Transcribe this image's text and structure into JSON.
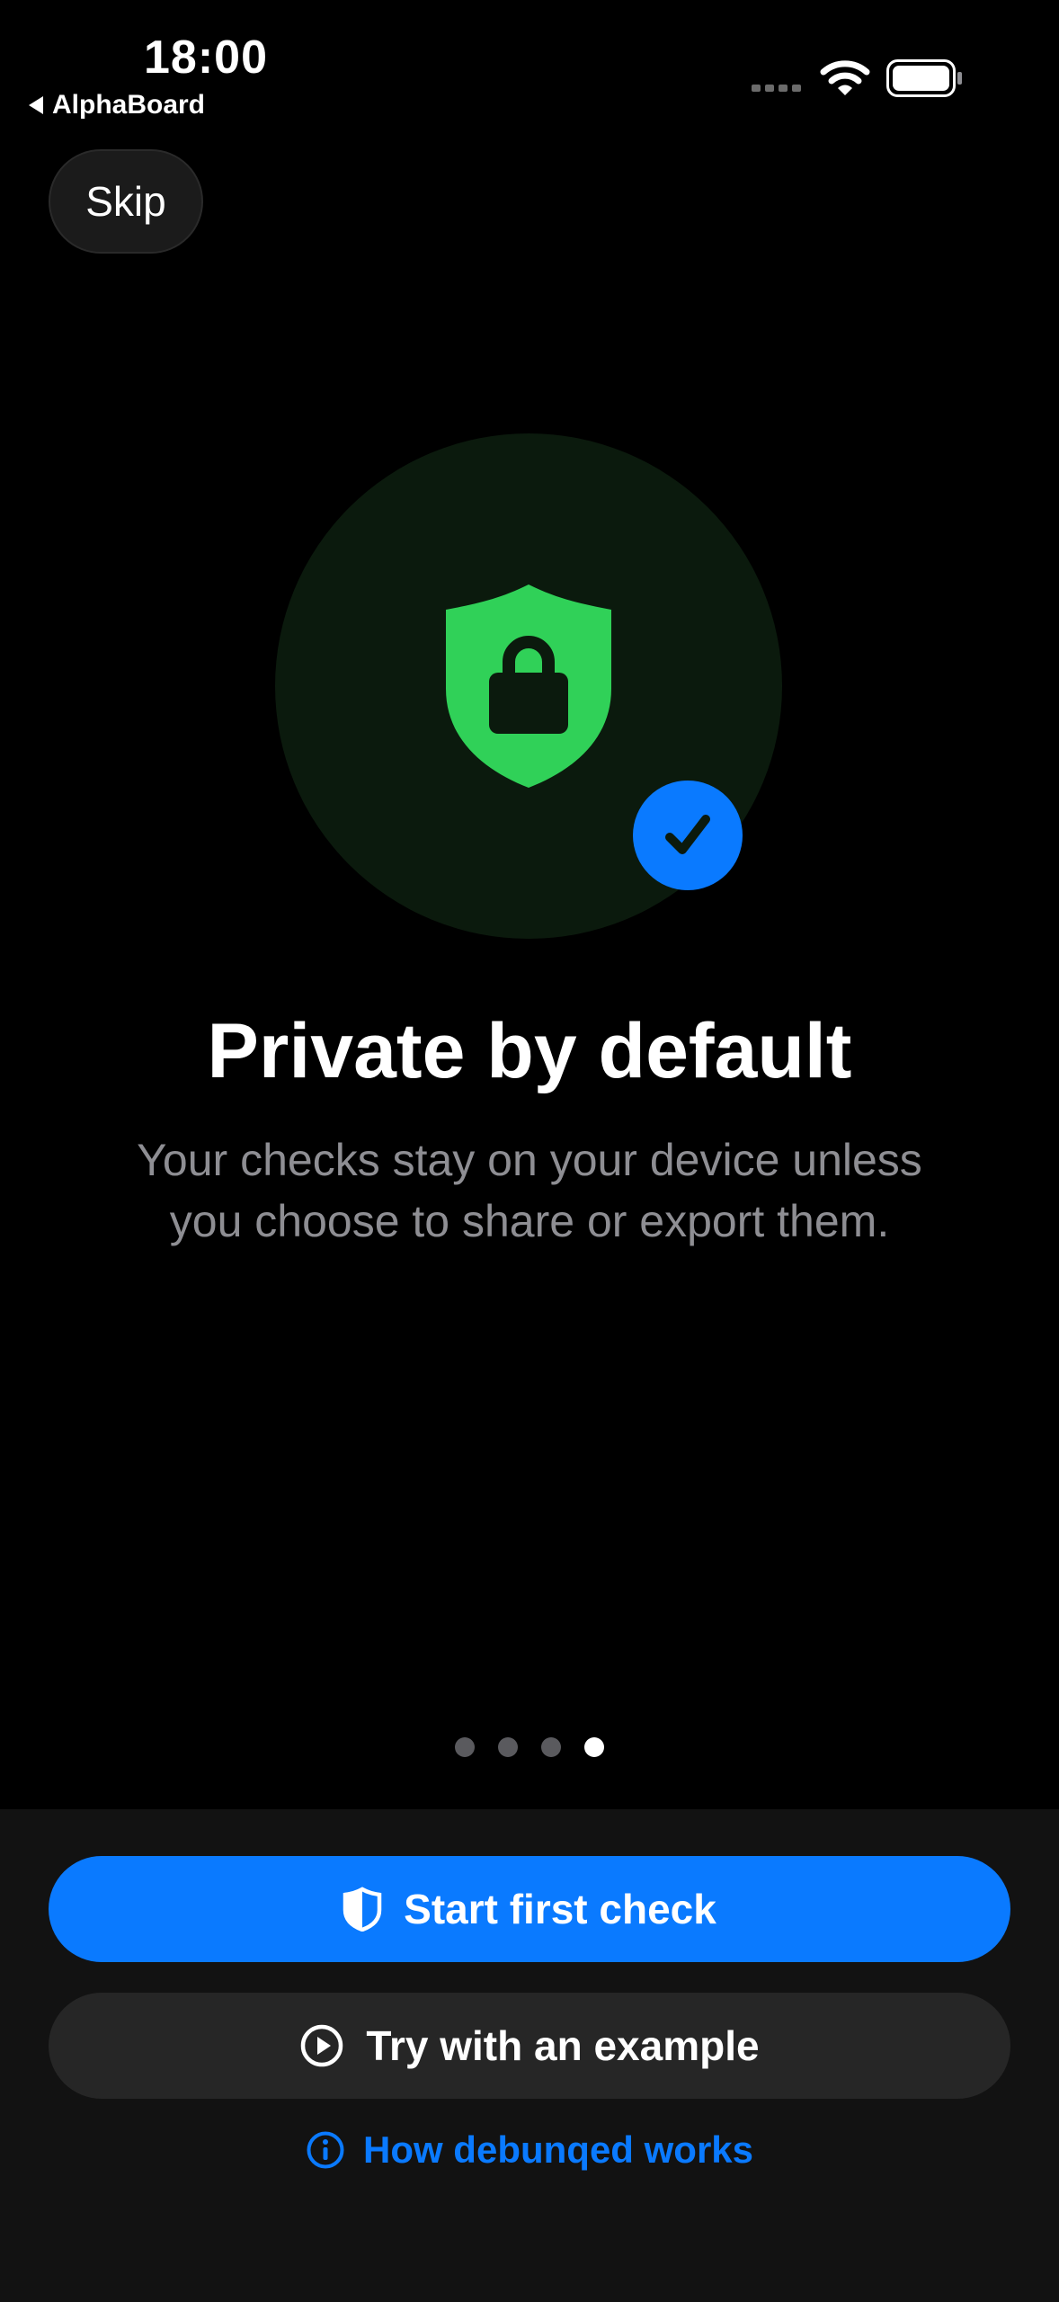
{
  "status_bar": {
    "time": "18:00",
    "back_app": "AlphaBoard",
    "icons": [
      "signal-icon",
      "wifi-icon",
      "battery-icon"
    ]
  },
  "onboarding": {
    "skip_label": "Skip",
    "hero_icon": "shield-lock-icon",
    "badge_icon": "checkmark-icon",
    "title": "Private by default",
    "subtitle": "Your checks stay on your device unless you choose to share or export them.",
    "page_count": 4,
    "current_page": 4
  },
  "actions": {
    "primary_label": "Start first check",
    "primary_icon": "shield-icon",
    "secondary_label": "Try with an example",
    "secondary_icon": "play-circle-icon",
    "link_label": "How debunqed works",
    "link_icon": "info-icon"
  },
  "colors": {
    "accent": "#0a7aff",
    "shield_green": "#30d158",
    "hero_circle": "#0b1a0d",
    "background": "#000000",
    "panel": "#121212",
    "secondary_button": "#262626",
    "muted_text": "#8e8e93"
  }
}
